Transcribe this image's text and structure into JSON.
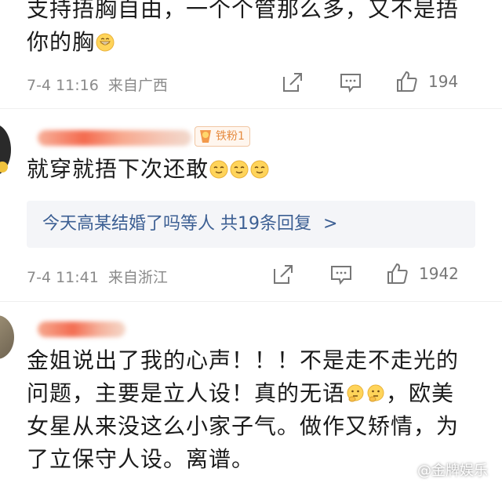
{
  "comments": [
    {
      "text_line1": "支持捂胸自由，一个个管那么多，又不是捂",
      "text_line2": "你的胸",
      "emoji_icon": "grinning-face-icon",
      "date": "7-4 11:16",
      "location": "来自广西",
      "likes": "194"
    },
    {
      "badge": "铁粉1",
      "text": "就穿就捂下次还敢",
      "emoji_icon": "smiling-face-icon",
      "reply_link": "今天高某结婚了吗等人  共19条回复",
      "reply_chevron": ">",
      "date": "7-4 11:41",
      "location": "来自浙江",
      "likes": "1942"
    },
    {
      "text_line1": "金姐说出了我的心声！！！不是走不走光的",
      "text_line2": "问题，主要是立人设！真的无语",
      "text_line2_tail": "，欧美",
      "text_line3": "女星从来没这么小家子气。做作又矫情，为",
      "text_line4": "了立保守人设。离谱。",
      "emoji_icon": "thinking-face-icon"
    }
  ],
  "watermark": "@金牌娱乐",
  "colors": {
    "link": "#3c5f93",
    "meta": "#8a8a8a",
    "reply_bg": "#f4f5f8",
    "badge": "#e58a3e"
  }
}
